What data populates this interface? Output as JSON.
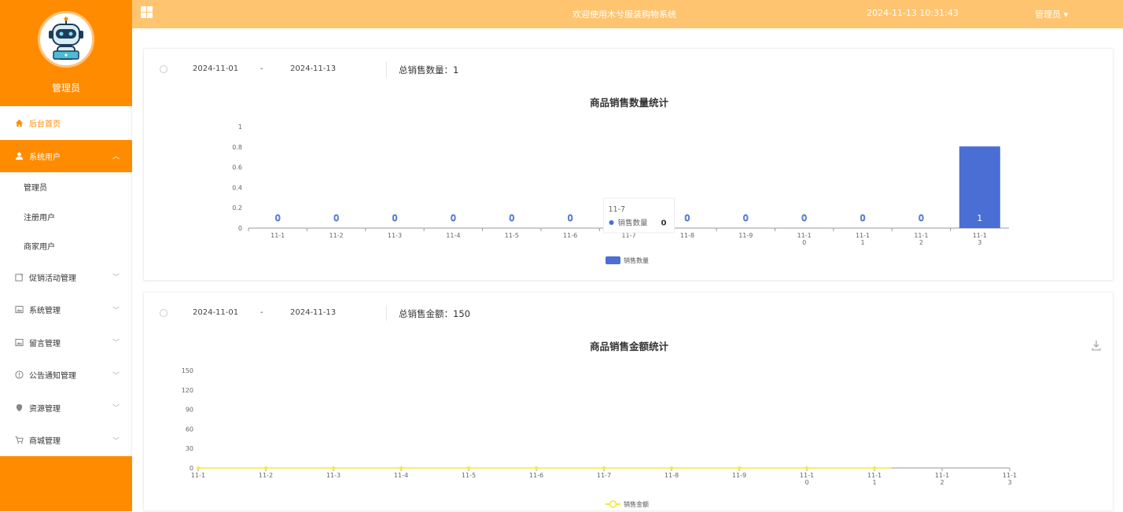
{
  "sidebar": {
    "username": "管理员",
    "items": [
      {
        "label": "后台首页",
        "icon": "home-icon"
      },
      {
        "label": "系统用户",
        "icon": "user-icon"
      },
      {
        "label": "促销活动管理",
        "icon": "note-icon"
      },
      {
        "label": "系统管理",
        "icon": "image-icon"
      },
      {
        "label": "留言管理",
        "icon": "image-icon"
      },
      {
        "label": "公告通知管理",
        "icon": "info-icon"
      },
      {
        "label": "资源管理",
        "icon": "pin-icon"
      },
      {
        "label": "商城管理",
        "icon": "cart-icon"
      }
    ],
    "subitems": [
      "管理员",
      "注册用户",
      "商家用户"
    ]
  },
  "topbar": {
    "title": "欢迎使用木兮服装购物系统",
    "datetime": "2024-11-13 10:31:43",
    "user": "管理员 ▾"
  },
  "panel1": {
    "start": "2024-11-01",
    "sep": "-",
    "end": "2024-11-13",
    "total_label": "总销售数量：1"
  },
  "panel2": {
    "start": "2024-11-01",
    "sep": "-",
    "end": "2024-11-13",
    "total_label": "总销售金额：150"
  },
  "chart_data": [
    {
      "type": "bar",
      "title": "商品销售数量统计",
      "categories": [
        "11-1",
        "11-2",
        "11-3",
        "11-4",
        "11-5",
        "11-6",
        "11-7",
        "11-8",
        "11-9",
        "11-10",
        "11-11",
        "11-12",
        "11-13"
      ],
      "series": [
        {
          "name": "销售数量",
          "values": [
            0,
            0,
            0,
            0,
            0,
            0,
            0,
            0,
            0,
            0,
            0,
            0,
            1
          ]
        }
      ],
      "ylim": [
        0,
        1
      ],
      "yticks": [
        "0",
        "0.2",
        "0.4",
        "0.6",
        "0.8",
        "1"
      ],
      "color": "#4a6ed3",
      "tooltip": {
        "category": "11-7",
        "series": "销售数量",
        "value": "0"
      },
      "legend": "bottom-center"
    },
    {
      "type": "line",
      "title": "商品销售金额统计",
      "categories": [
        "11-1",
        "11-2",
        "11-3",
        "11-4",
        "11-5",
        "11-6",
        "11-7",
        "11-8",
        "11-9",
        "11-10",
        "11-11",
        "11-12",
        "11-13"
      ],
      "series": [
        {
          "name": "销售金额",
          "values": [
            0,
            0,
            0,
            0,
            0,
            0,
            0,
            0,
            0,
            0,
            0,
            null,
            null
          ]
        }
      ],
      "ylim": [
        0,
        150
      ],
      "yticks": [
        "0",
        "30",
        "60",
        "90",
        "120",
        "150"
      ],
      "color": "#f5e83a",
      "legend": "bottom-center"
    }
  ]
}
